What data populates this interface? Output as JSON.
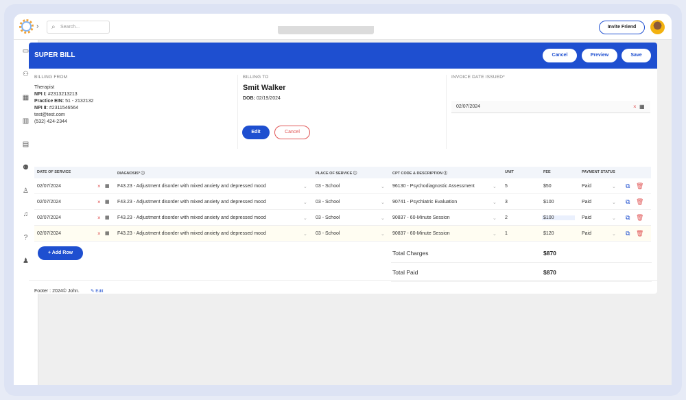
{
  "topbar": {
    "search_placeholder": "Search...",
    "invite_label": "Invite Friend"
  },
  "header": {
    "title": "SUPER BILL",
    "cancel": "Cancel",
    "preview": "Preview",
    "save": "Save"
  },
  "billing_from": {
    "label": "BILLING FROM",
    "role": "Therapist",
    "npi1_label": "NPI I:",
    "npi1": "#2313213213",
    "ein_label": "Practice EIN:",
    "ein": "51 - 2132132",
    "npi2_label": "NPI II:",
    "npi2": "#2311546564",
    "email": "test@test.com",
    "phone": "(532) 424-2344"
  },
  "billing_to": {
    "label": "BILLING TO",
    "name": "Smit Walker",
    "dob_label": "DOB:",
    "dob": "02/19/2024",
    "edit": "Edit",
    "cancel": "Cancel"
  },
  "invoice": {
    "label": "INVOICE DATE ISSUED*",
    "date": "02/07/2024"
  },
  "table": {
    "headers": {
      "date": "DATE OF SERVICE",
      "diagnosis": "DIAGNOSIS*",
      "place": "PLACE OF SERVICE",
      "cpt": "CPT CODE & DESCRIPTION",
      "unit": "UNIT",
      "fee": "FEE",
      "status": "PAYMENT STATUS"
    },
    "rows": [
      {
        "date": "02/07/2024",
        "diagnosis": "F43.23 - Adjustment disorder with mixed anxiety and depressed mood",
        "place": "03 - School",
        "cpt": "96130 - Psychodiagnostic Assessment",
        "unit": "5",
        "fee": "$50",
        "status": "Paid"
      },
      {
        "date": "02/07/2024",
        "diagnosis": "F43.23 - Adjustment disorder with mixed anxiety and depressed mood",
        "place": "03 - School",
        "cpt": "90741 - Psychiatric Evaluation",
        "unit": "3",
        "fee": "$100",
        "status": "Paid"
      },
      {
        "date": "02/07/2024",
        "diagnosis": "F43.23 - Adjustment disorder with mixed anxiety and depressed mood",
        "place": "03 - School",
        "cpt": "90837 - 60-Minute Session",
        "unit": "2",
        "fee": "$100",
        "status": "Paid"
      },
      {
        "date": "02/07/2024",
        "diagnosis": "F43.23 - Adjustment disorder with mixed anxiety and depressed mood",
        "place": "03 - School",
        "cpt": "90837 - 60-Minute Session",
        "unit": "1",
        "fee": "$120",
        "status": "Paid"
      }
    ]
  },
  "add_row": "+ Add Row",
  "totals": {
    "charges_label": "Total Charges",
    "charges": "$870",
    "paid_label": "Total Paid",
    "paid": "$870"
  },
  "footer": {
    "text": "Footer : 2024© John.",
    "edit": "Edit"
  },
  "colors": {
    "primary": "#1e4fd0",
    "danger": "#e05555"
  }
}
